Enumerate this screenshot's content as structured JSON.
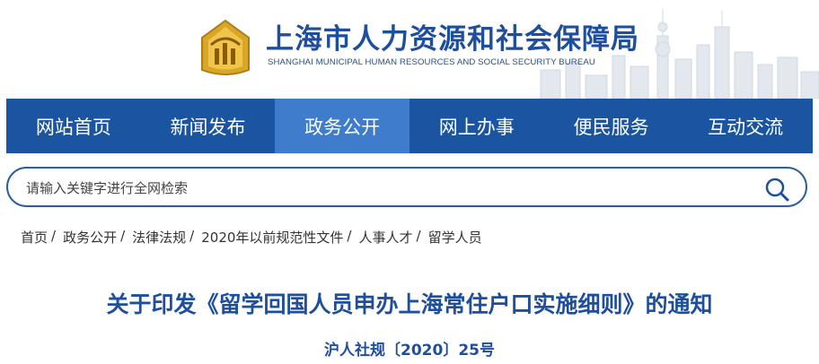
{
  "header": {
    "title": "上海市人力资源和社会保障局",
    "subtitle": "SHANGHAI MUNICIPAL HUMAN RESOURCES AND SOCIAL SECURITY BUREAU",
    "logo_icon": "bureau-emblem-icon",
    "background_icon": "shanghai-skyline-icon"
  },
  "nav": {
    "items": [
      {
        "label": "网站首页"
      },
      {
        "label": "新闻发布"
      },
      {
        "label": "政务公开",
        "active": true
      },
      {
        "label": "网上办事"
      },
      {
        "label": "便民服务"
      },
      {
        "label": "互动交流"
      }
    ],
    "bg_color": "#1b55a1",
    "active_color": "#3f7ccb"
  },
  "search": {
    "placeholder": "请输入关键字进行全网检索",
    "icon": "search-icon"
  },
  "breadcrumb": [
    {
      "label": "首页"
    },
    {
      "label": "政务公开"
    },
    {
      "label": "法律法规"
    },
    {
      "label": "2020年以前规范性文件"
    },
    {
      "label": "人事人才"
    },
    {
      "label": "留学人员"
    }
  ],
  "article": {
    "title": "关于印发《留学回国人员申办上海常住户口实施细则》的通知",
    "doc_number": "沪人社规〔2020〕25号",
    "title_color": "#1e4f9c"
  }
}
